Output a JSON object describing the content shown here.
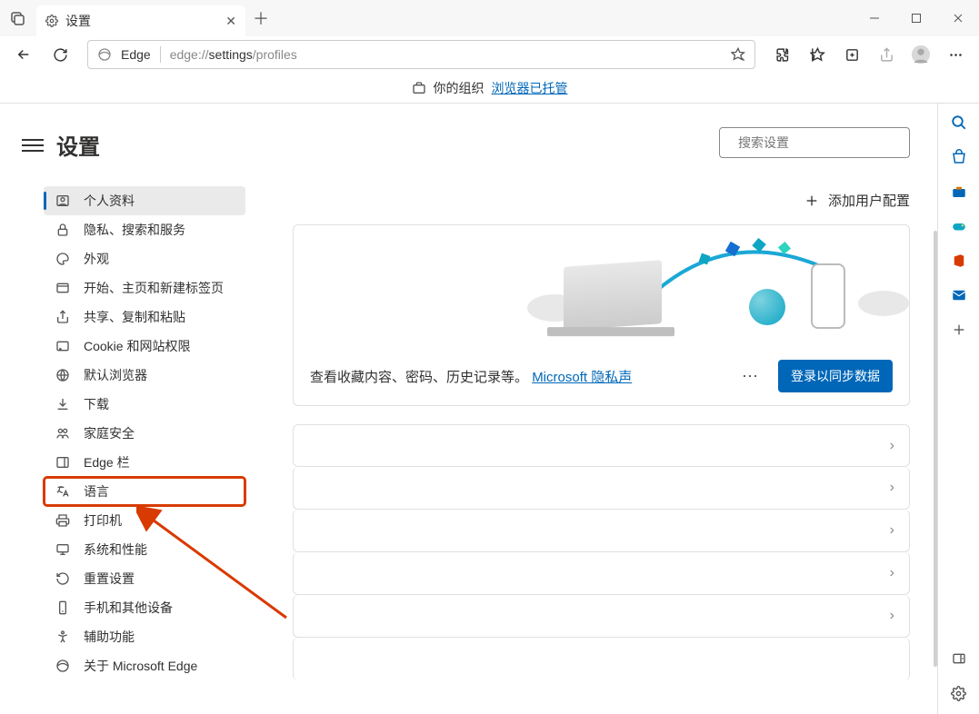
{
  "tab_title": "设置",
  "omnibox_brand": "Edge",
  "url_prefix": "edge://",
  "url_bold": "settings",
  "url_suffix": "/profiles",
  "infobar_prefix": "你的组织",
  "infobar_link": "浏览器已托管",
  "page_title": "设置",
  "search_placeholder": "搜索设置",
  "add_profile": "添加用户配置",
  "promo_text_prefix": "查看收藏内容、密码、历史记录等。",
  "promo_link": "Microsoft 隐私声",
  "sync_button": "登录以同步数据",
  "nav": {
    "profile": "个人资料",
    "privacy": "隐私、搜索和服务",
    "appearance": "外观",
    "start": "开始、主页和新建标签页",
    "share": "共享、复制和粘贴",
    "cookies": "Cookie 和网站权限",
    "default": "默认浏览器",
    "downloads": "下载",
    "family": "家庭安全",
    "edgebar": "Edge 栏",
    "language": "语言",
    "printer": "打印机",
    "system": "系统和性能",
    "reset": "重置设置",
    "phone": "手机和其他设备",
    "access": "辅助功能",
    "about": "关于 Microsoft Edge"
  }
}
